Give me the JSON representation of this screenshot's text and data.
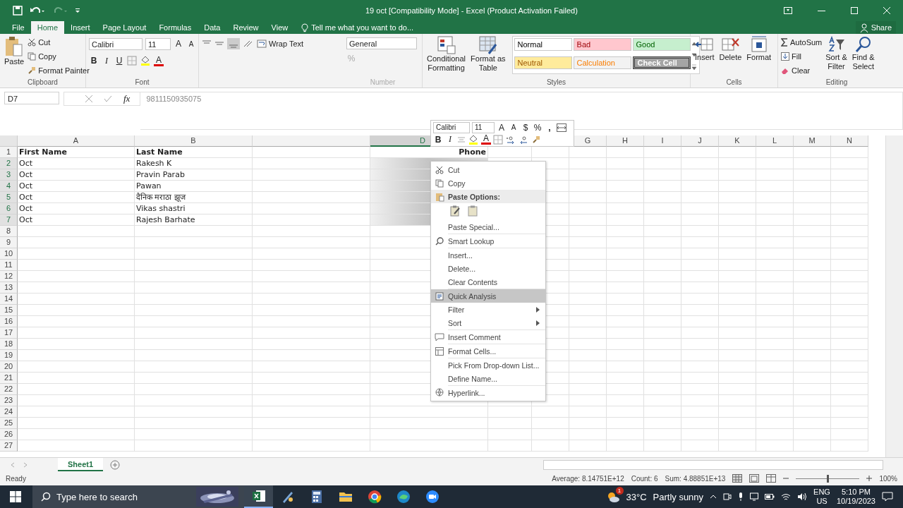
{
  "window": {
    "title": "19 oct  [Compatibility Mode] - Excel (Product Activation Failed)"
  },
  "tabs": [
    {
      "label": "File",
      "selected": false
    },
    {
      "label": "Home",
      "selected": true
    },
    {
      "label": "Insert",
      "selected": false
    },
    {
      "label": "Page Layout",
      "selected": false
    },
    {
      "label": "Formulas",
      "selected": false
    },
    {
      "label": "Data",
      "selected": false
    },
    {
      "label": "Review",
      "selected": false
    },
    {
      "label": "View",
      "selected": false
    }
  ],
  "tell_me": "Tell me what you want to do...",
  "share": "Share",
  "ribbon": {
    "clipboard": {
      "paste": "Paste",
      "cut": "Cut",
      "copy": "Copy",
      "format_painter": "Format Painter",
      "label": "Clipboard"
    },
    "font": {
      "name": "Calibri",
      "size": "11",
      "grow": "A",
      "shrink": "A",
      "bold": "B",
      "italic": "I",
      "underline": "U",
      "font_color": "A",
      "label": "Font"
    },
    "alignment": {
      "wrap_text": "Wrap Text"
    },
    "number": {
      "format": "General",
      "percent": "%",
      "label": "Number"
    },
    "styles": {
      "conditional": [
        "Conditional",
        "Formatting"
      ],
      "format_table": [
        "Format as",
        "Table"
      ],
      "label": "Styles",
      "cells": [
        {
          "label": "Normal",
          "color": "#ffffff"
        },
        {
          "label": "Bad",
          "color": "#ffc7ce"
        },
        {
          "label": "Good",
          "color": "#c6efce"
        },
        {
          "label": "Neutral",
          "color": "#ffeb9c"
        },
        {
          "label": "Calculation",
          "color": "#f2f2f2"
        },
        {
          "label": "Check Cell",
          "color": "#a5a5a5"
        }
      ]
    },
    "cells": {
      "insert": "Insert",
      "delete": "Delete",
      "format": "Format",
      "label": "Cells"
    },
    "editing": {
      "autosum": "AutoSum",
      "fill": "Fill",
      "clear": "Clear",
      "sort": [
        "Sort &",
        "Filter"
      ],
      "find": [
        "Find &",
        "Select"
      ],
      "label": "Editing"
    }
  },
  "formula_bar": {
    "name_box": "D7",
    "fx": "fx",
    "value": "9811150935075"
  },
  "columns": [
    {
      "label": "A",
      "selected": false
    },
    {
      "label": "B",
      "selected": false
    },
    {
      "label": "D",
      "selected": true
    },
    {
      "label": "G",
      "selected": false
    },
    {
      "label": "H",
      "selected": false
    },
    {
      "label": "I",
      "selected": false
    },
    {
      "label": "J",
      "selected": false
    },
    {
      "label": "K",
      "selected": false
    },
    {
      "label": "L",
      "selected": false
    },
    {
      "label": "M",
      "selected": false
    },
    {
      "label": "N",
      "selected": false
    }
  ],
  "rows": [
    {
      "number": "1",
      "first": "First Name",
      "last": "Last Name",
      "phone": "Phone",
      "selected": false
    },
    {
      "number": "2",
      "first": "Oct",
      "last": "Rakesh K",
      "selected": true
    },
    {
      "number": "3",
      "first": "Oct",
      "last": "Pravin Parab",
      "selected": true
    },
    {
      "number": "4",
      "first": "Oct",
      "last": "Pawan",
      "selected": true
    },
    {
      "number": "5",
      "first": "Oct",
      "last": "दैनिक मराठा झूज",
      "selected": true
    },
    {
      "number": "6",
      "first": "Oct",
      "last": "Vikas shastri",
      "selected": true
    },
    {
      "number": "7",
      "first": "Oct",
      "last": "Rajesh Barhate",
      "selected": true
    },
    {
      "number": "8",
      "selected": false
    },
    {
      "number": "9",
      "selected": false
    },
    {
      "number": "10",
      "selected": false
    },
    {
      "number": "11",
      "selected": false
    },
    {
      "number": "12",
      "selected": false
    },
    {
      "number": "13",
      "selected": false
    },
    {
      "number": "14",
      "selected": false
    },
    {
      "number": "15",
      "selected": false
    },
    {
      "number": "16",
      "selected": false
    },
    {
      "number": "17",
      "selected": false
    },
    {
      "number": "18",
      "selected": false
    },
    {
      "number": "19",
      "selected": false
    },
    {
      "number": "20",
      "selected": false
    },
    {
      "number": "21",
      "selected": false
    },
    {
      "number": "22",
      "selected": false
    },
    {
      "number": "23",
      "selected": false
    },
    {
      "number": "24",
      "selected": false
    },
    {
      "number": "25",
      "selected": false
    },
    {
      "number": "26",
      "selected": false
    },
    {
      "number": "27",
      "selected": false
    }
  ],
  "mini_toolbar": {
    "font": "Calibri",
    "size": "11",
    "grow": "A",
    "shrink": "A",
    "currency": "$",
    "percent": "%",
    "comma": ",",
    "bold": "B",
    "italic": "I",
    "font_color": "A"
  },
  "context_menu": [
    {
      "label": "Cut",
      "kind": "cut",
      "selected": false
    },
    {
      "label": "Copy",
      "kind": "copy",
      "selected": false
    },
    {
      "label": "Paste Options:",
      "kind": "header",
      "selected": false
    },
    {
      "kind": "paste_icons"
    },
    {
      "label": "Paste Special...",
      "kind": "plain",
      "selected": false
    },
    {
      "label": "Smart Lookup",
      "kind": "lookup",
      "selected": false,
      "separator_before": true
    },
    {
      "label": "Insert...",
      "kind": "plain",
      "selected": false,
      "separator_before": true
    },
    {
      "label": "Delete...",
      "kind": "plain",
      "selected": false
    },
    {
      "label": "Clear Contents",
      "kind": "plain",
      "selected": false
    },
    {
      "label": "Quick Analysis",
      "kind": "analysis",
      "selected": true,
      "separator_before": true
    },
    {
      "label": "Filter",
      "kind": "submenu",
      "selected": false
    },
    {
      "label": "Sort",
      "kind": "submenu",
      "selected": false
    },
    {
      "label": "Insert Comment",
      "kind": "comment",
      "selected": false,
      "separator_before": true
    },
    {
      "label": "Format Cells...",
      "kind": "format",
      "selected": false,
      "separator_before": true
    },
    {
      "label": "Pick From Drop-down List...",
      "kind": "plain",
      "selected": false,
      "separator_before": true
    },
    {
      "label": "Define Name...",
      "kind": "plain",
      "selected": false
    },
    {
      "label": "Hyperlink...",
      "kind": "link",
      "selected": false,
      "separator_before": true
    }
  ],
  "sheet_tabs": [
    {
      "label": "Sheet1",
      "selected": true
    }
  ],
  "status_bar": {
    "status": "Ready",
    "average": "Average: 8.14751E+12",
    "count": "Count: 6",
    "sum": "Sum: 4.88851E+13",
    "zoom": "100%",
    "level": 0.5
  },
  "taskbar": {
    "search_placeholder": "Type here to search",
    "apps": [
      {
        "kind": "excel",
        "active": true
      },
      {
        "kind": "paint",
        "active": false
      },
      {
        "kind": "calculator",
        "active": false
      },
      {
        "kind": "folder",
        "active": false
      },
      {
        "kind": "chrome",
        "active": false
      },
      {
        "kind": "edge",
        "active": false
      },
      {
        "kind": "zoom",
        "active": false
      }
    ],
    "weather_badge": "1",
    "temperature": "33°C",
    "weather": "Partly sunny",
    "language": "ENG",
    "region": "US",
    "time": "5:10 PM",
    "date": "10/19/2023"
  }
}
